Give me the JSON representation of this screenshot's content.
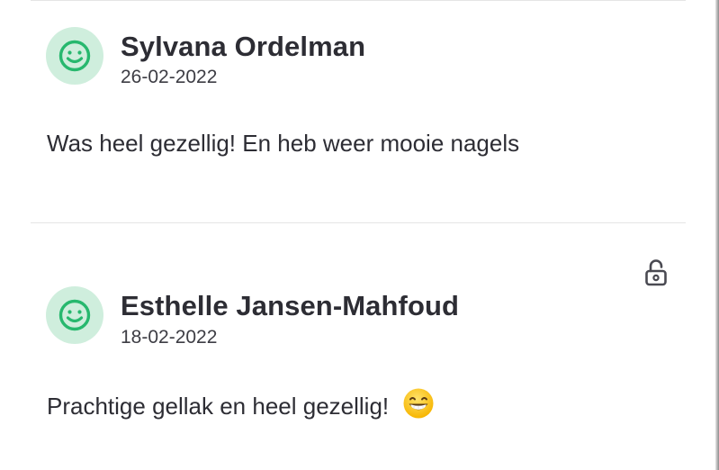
{
  "reviews": [
    {
      "name": "Sylvana Ordelman",
      "date": "26-02-2022",
      "text": "Was heel gezellig! En heb weer mooie nagels",
      "avatar_icon": "smiley-face-icon"
    },
    {
      "name": "Esthelle Jansen-Mahfoud",
      "date": "18-02-2022",
      "text": "Prachtige gellak en heel gezellig!",
      "emoji": "grinning-face-icon",
      "avatar_icon": "smiley-face-icon",
      "action_icon": "unlock-icon"
    }
  ],
  "colors": {
    "avatar_bg": "#cfeedd",
    "avatar_icon": "#27b86e",
    "text": "#2d2d34",
    "divider": "#e5e5e5"
  }
}
